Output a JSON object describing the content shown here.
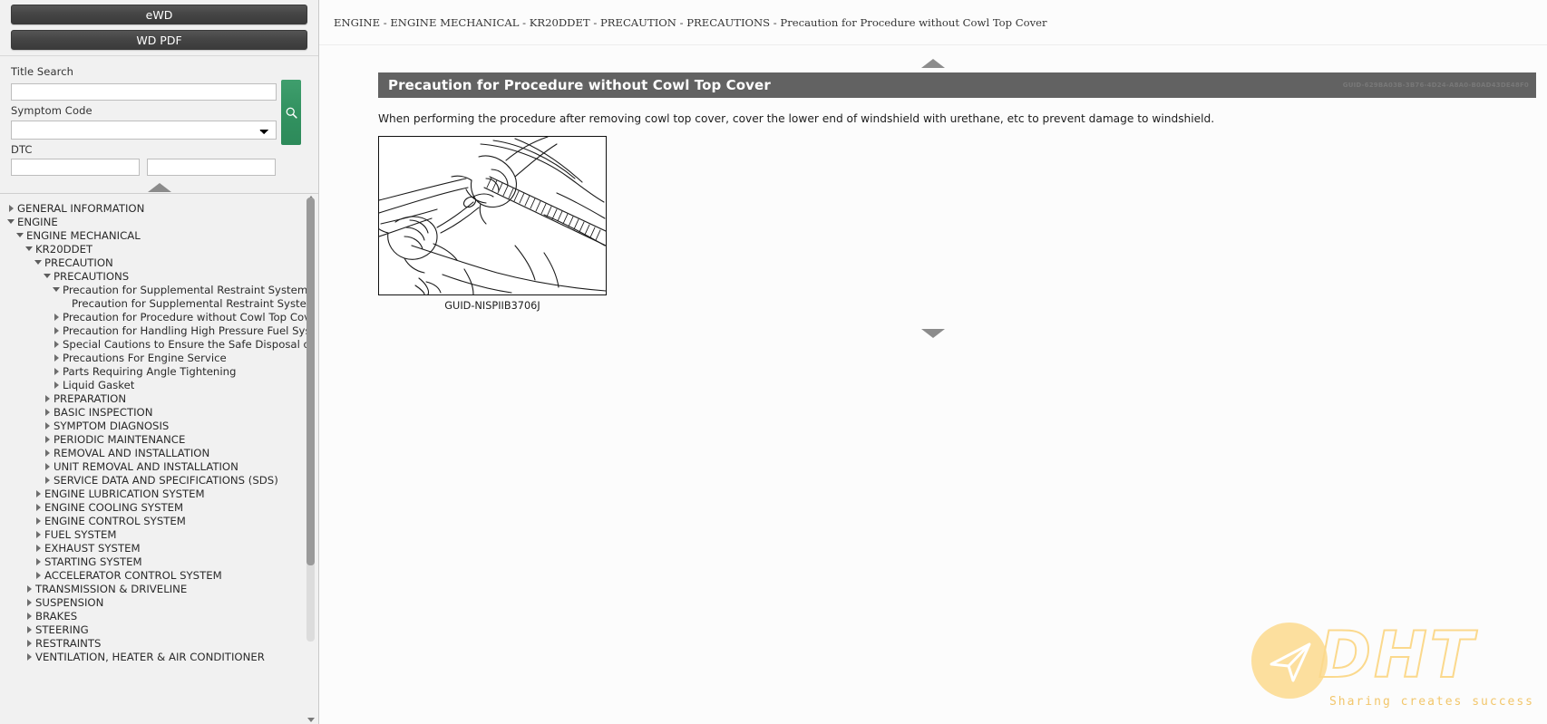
{
  "sidebar": {
    "buttons": [
      {
        "label": "eWD",
        "name": "ewd-button"
      },
      {
        "label": "WD PDF",
        "name": "wd-pdf-button"
      }
    ],
    "search": {
      "title_search_label": "Title Search",
      "title_search_value": "",
      "title_search_placeholder": "",
      "symptom_code_label": "Symptom Code",
      "symptom_code_value": "",
      "dtc_label": "DTC",
      "dtc_value_1": "",
      "dtc_value_2": "",
      "search_icon": "search-icon",
      "collapse_icon": "chevron-up-icon"
    },
    "tree": [
      {
        "label": "GENERAL INFORMATION",
        "depth": 0,
        "state": "collapsed"
      },
      {
        "label": "ENGINE",
        "depth": 0,
        "state": "expanded"
      },
      {
        "label": "ENGINE MECHANICAL",
        "depth": 1,
        "state": "expanded"
      },
      {
        "label": "KR20DDET",
        "depth": 2,
        "state": "expanded"
      },
      {
        "label": "PRECAUTION",
        "depth": 3,
        "state": "expanded"
      },
      {
        "label": "PRECAUTIONS",
        "depth": 4,
        "state": "expanded"
      },
      {
        "label": "Precaution for Supplemental Restraint System (SRS)",
        "depth": 5,
        "state": "expanded"
      },
      {
        "label": "Precaution for Supplemental Restraint System (SRS)",
        "depth": 6,
        "state": "leaf"
      },
      {
        "label": "Precaution for Procedure without Cowl Top Cover",
        "depth": 5,
        "state": "collapsed"
      },
      {
        "label": "Precaution for Handling High Pressure Fuel System",
        "depth": 5,
        "state": "collapsed"
      },
      {
        "label": "Special Cautions to Ensure the Safe Disposal of",
        "depth": 5,
        "state": "collapsed"
      },
      {
        "label": "Precautions For Engine Service",
        "depth": 5,
        "state": "collapsed"
      },
      {
        "label": "Parts Requiring Angle Tightening",
        "depth": 5,
        "state": "collapsed"
      },
      {
        "label": "Liquid Gasket",
        "depth": 5,
        "state": "collapsed"
      },
      {
        "label": "PREPARATION",
        "depth": 4,
        "state": "collapsed"
      },
      {
        "label": "BASIC INSPECTION",
        "depth": 4,
        "state": "collapsed"
      },
      {
        "label": "SYMPTOM DIAGNOSIS",
        "depth": 4,
        "state": "collapsed"
      },
      {
        "label": "PERIODIC MAINTENANCE",
        "depth": 4,
        "state": "collapsed"
      },
      {
        "label": "REMOVAL AND INSTALLATION",
        "depth": 4,
        "state": "collapsed"
      },
      {
        "label": "UNIT REMOVAL AND INSTALLATION",
        "depth": 4,
        "state": "collapsed"
      },
      {
        "label": "SERVICE DATA AND SPECIFICATIONS (SDS)",
        "depth": 4,
        "state": "collapsed"
      },
      {
        "label": "ENGINE LUBRICATION SYSTEM",
        "depth": 3,
        "state": "collapsed"
      },
      {
        "label": "ENGINE COOLING SYSTEM",
        "depth": 3,
        "state": "collapsed"
      },
      {
        "label": "ENGINE CONTROL SYSTEM",
        "depth": 3,
        "state": "collapsed"
      },
      {
        "label": "FUEL SYSTEM",
        "depth": 3,
        "state": "collapsed"
      },
      {
        "label": "EXHAUST SYSTEM",
        "depth": 3,
        "state": "collapsed"
      },
      {
        "label": "STARTING SYSTEM",
        "depth": 3,
        "state": "collapsed"
      },
      {
        "label": "ACCELERATOR CONTROL SYSTEM",
        "depth": 3,
        "state": "collapsed"
      },
      {
        "label": "TRANSMISSION & DRIVELINE",
        "depth": 2,
        "state": "collapsed"
      },
      {
        "label": "SUSPENSION",
        "depth": 2,
        "state": "collapsed"
      },
      {
        "label": "BRAKES",
        "depth": 2,
        "state": "collapsed"
      },
      {
        "label": "STEERING",
        "depth": 2,
        "state": "collapsed"
      },
      {
        "label": "RESTRAINTS",
        "depth": 2,
        "state": "collapsed"
      },
      {
        "label": "VENTILATION, HEATER & AIR CONDITIONER",
        "depth": 2,
        "state": "collapsed"
      }
    ]
  },
  "main": {
    "breadcrumb": "ENGINE - ENGINE MECHANICAL - KR20DDET - PRECAUTION - PRECAUTIONS - Precaution for Procedure without Cowl Top Cover",
    "nav_up_icon": "chevron-up-icon",
    "nav_down_icon": "chevron-down-icon",
    "section_title": "Precaution for Procedure without Cowl Top Cover",
    "section_guid": "GUID-629BA03B-3B76-4D24-A8A0-B0AD43DE48F0",
    "body_text": "When performing the procedure after removing cowl top cover, cover the lower end of windshield with urethane, etc to prevent damage to windshield.",
    "figure_caption": "GUID-NISPIIB3706J"
  },
  "watermark": {
    "brand": "DHT",
    "tagline": "Sharing creates success"
  },
  "colors": {
    "sidebar_bg": "#f1f1f1",
    "button_dark": "#444444",
    "search_green": "#2d8a5a",
    "title_bar": "#626262",
    "watermark_amber": "#fbd98d"
  }
}
